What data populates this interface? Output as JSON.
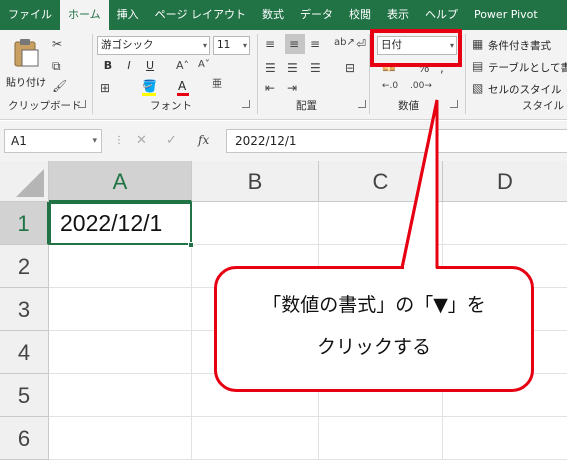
{
  "tabs": [
    "ファイル",
    "ホーム",
    "挿入",
    "ページ レイアウト",
    "数式",
    "データ",
    "校閲",
    "表示",
    "ヘルプ",
    "Power Pivot"
  ],
  "active_tab_index": 1,
  "ribbon": {
    "clipboard": {
      "paste_label": "貼り付け",
      "group_label": "クリップボード"
    },
    "font": {
      "font_name": "游ゴシック",
      "font_size": "11",
      "bold": "B",
      "italic": "I",
      "underline": "U",
      "group_label": "フォント"
    },
    "alignment": {
      "group_label": "配置"
    },
    "number": {
      "format_value": "日付",
      "percent": "%",
      "group_label": "数値"
    },
    "styles": {
      "conditional_format": "条件付き書式",
      "format_as_table": "テーブルとして書式",
      "cell_styles": "セルのスタイル",
      "group_label": "スタイル"
    }
  },
  "formula_bar": {
    "name_box": "A1",
    "fx": "fx",
    "value": "2022/12/1"
  },
  "grid": {
    "columns": [
      "A",
      "B",
      "C",
      "D"
    ],
    "rows": [
      "1",
      "2",
      "3",
      "4",
      "5",
      "6"
    ],
    "cells": {
      "A1": "2022/12/1"
    },
    "selected_cell": "A1"
  },
  "annotation": {
    "line1": "「数値の書式」の「▼」を",
    "line2": "クリックする"
  },
  "colors": {
    "excel_green": "#217346",
    "annotation_red": "#e60012"
  }
}
